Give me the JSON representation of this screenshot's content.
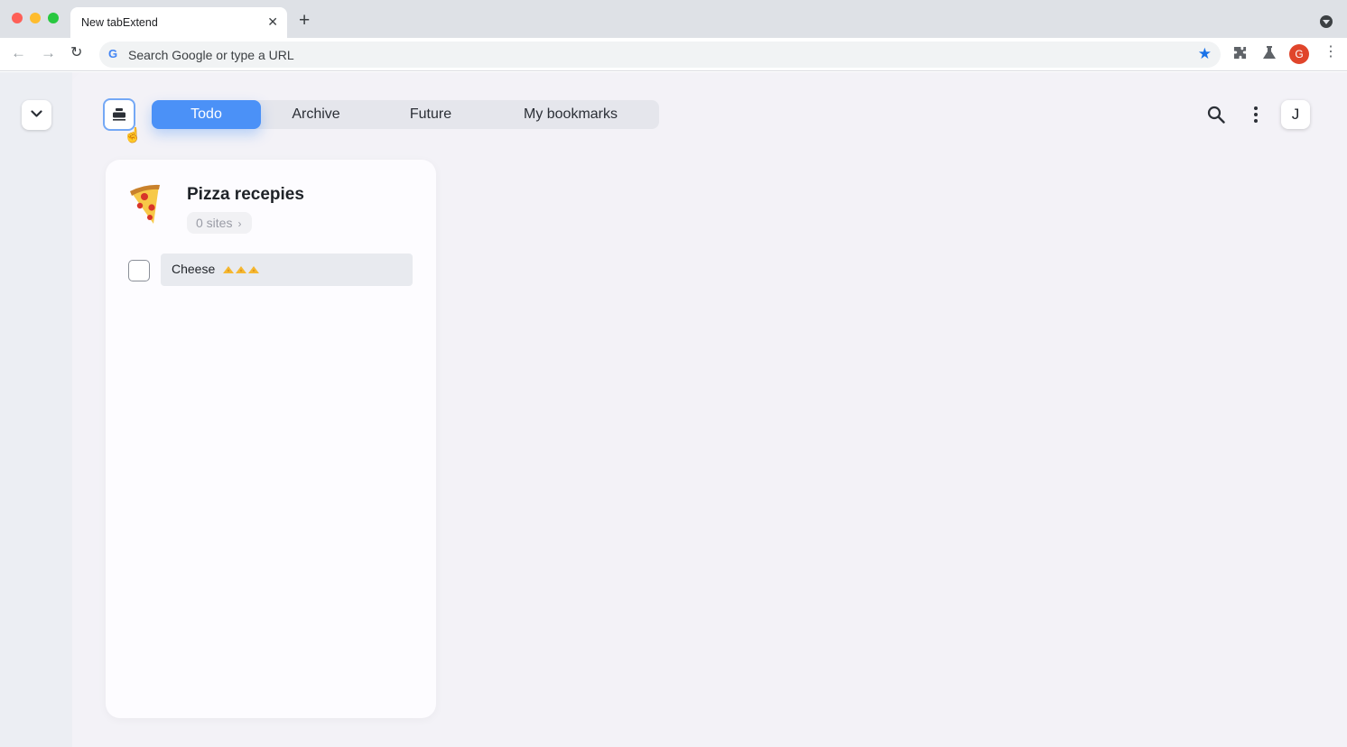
{
  "browser": {
    "tab_title": "New tabExtend",
    "tab_close": "✕",
    "new_tab": "+",
    "omnibox_placeholder": "Search Google or type a URL",
    "profile_initial": "G",
    "colors": {
      "accent_blue": "#1a73e8",
      "profile_red": "#e0452b"
    }
  },
  "app": {
    "tabs": [
      {
        "label": "Todo",
        "active": true
      },
      {
        "label": "Archive",
        "active": false
      },
      {
        "label": "Future",
        "active": false
      },
      {
        "label": "My bookmarks",
        "active": false
      }
    ],
    "user_initial": "J",
    "colors": {
      "active_tab": "#4b91f7",
      "stash_border": "#74a8f5"
    }
  },
  "card": {
    "title": "Pizza recepies",
    "sites": "0 sites",
    "todos": [
      {
        "text": "Cheese",
        "checked": false,
        "emoji": "cheese-icon x3"
      }
    ]
  }
}
